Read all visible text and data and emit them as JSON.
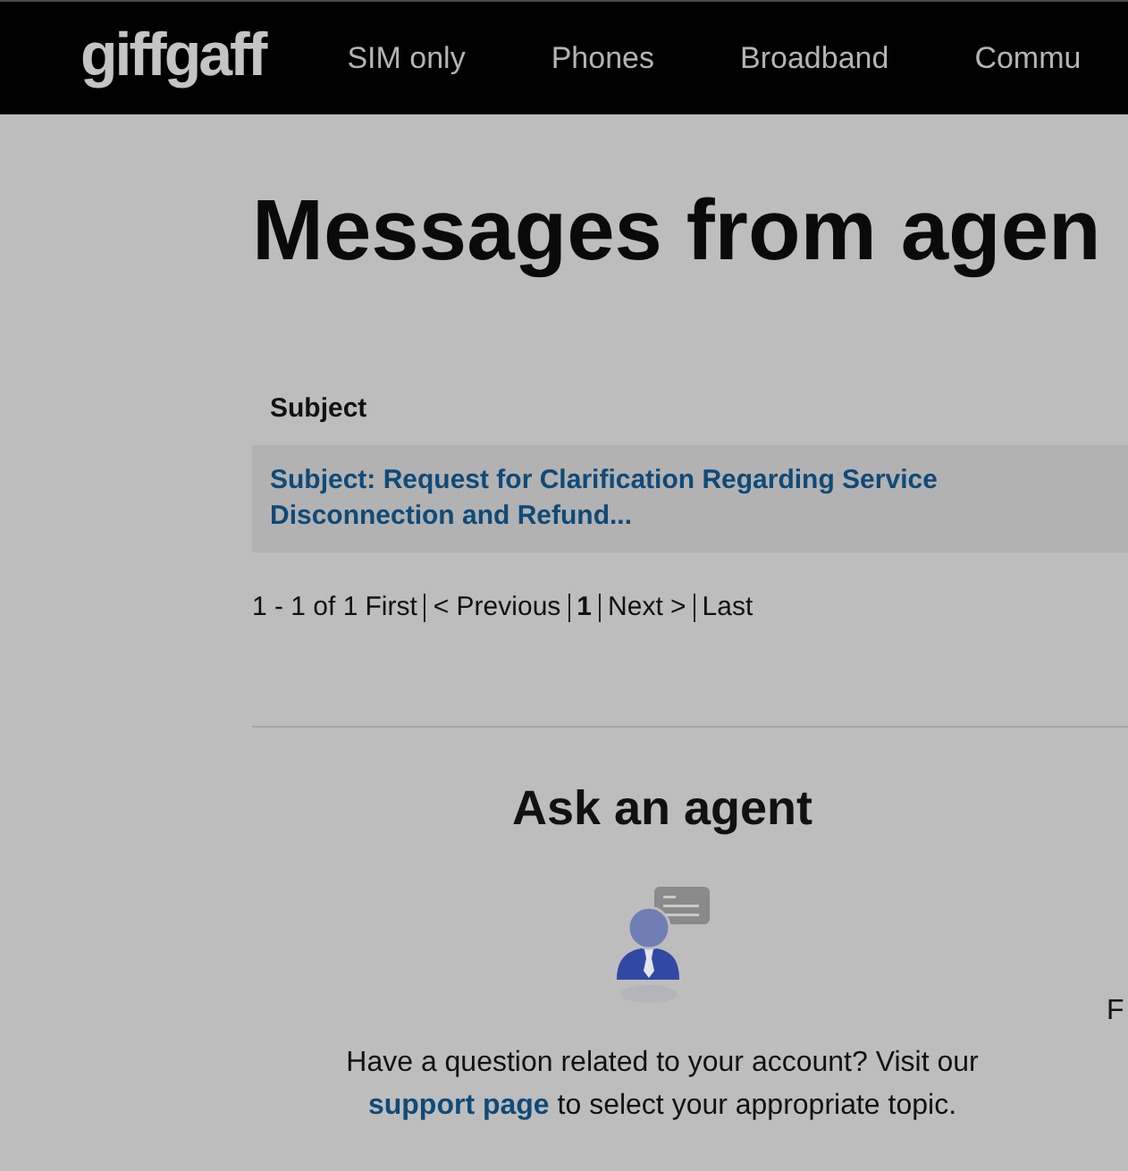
{
  "nav": {
    "logo": "giffgaff",
    "items": [
      "SIM only",
      "Phones",
      "Broadband",
      "Commu"
    ]
  },
  "page_title": "Messages from agen",
  "table": {
    "columns": [
      "Subject"
    ],
    "rows": [
      {
        "subject": "Subject: Request for Clarification Regarding Service Disconnection and Refund..."
      }
    ]
  },
  "pagination": {
    "summary": "1 - 1 of 1",
    "items": [
      {
        "label": "First",
        "selected": false
      },
      {
        "label": "< Previous",
        "selected": false
      },
      {
        "label": "1",
        "selected": true
      },
      {
        "label": "Next >",
        "selected": false
      },
      {
        "label": "Last",
        "selected": false
      }
    ]
  },
  "help_columns": [
    {
      "title": "Ask an agent",
      "text_before": "Have a question related to your account? Visit our",
      "link": "support page",
      "text_after": "to select your appropriate topic."
    },
    {
      "text_before": "F"
    }
  ]
}
